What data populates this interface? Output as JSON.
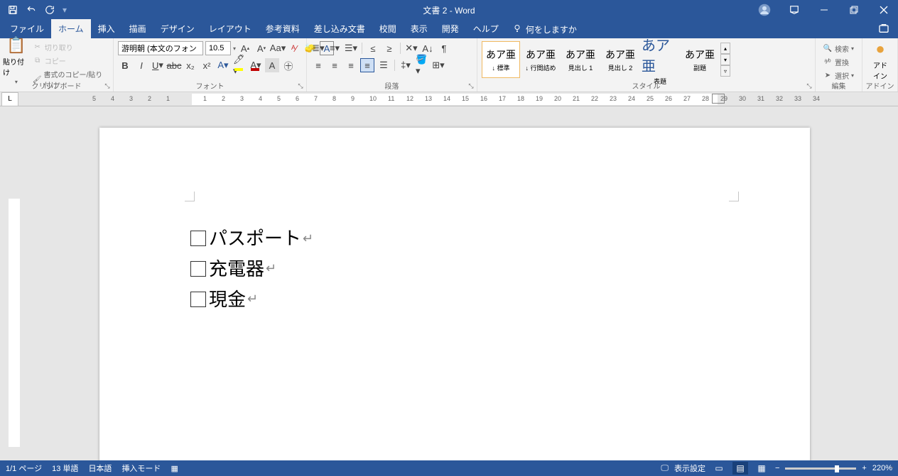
{
  "titlebar": {
    "title": "文書 2  -  Word"
  },
  "tabs": {
    "file": "ファイル",
    "home": "ホーム",
    "insert": "挿入",
    "draw": "描画",
    "design": "デザイン",
    "layout": "レイアウト",
    "references": "参考資料",
    "mailings": "差し込み文書",
    "review": "校閲",
    "view": "表示",
    "developer": "開発",
    "help": "ヘルプ",
    "tell_me": "何をしますか"
  },
  "ribbon": {
    "clipboard": {
      "label": "クリップボード",
      "paste": "貼り付け",
      "cut": "切り取り",
      "copy": "コピー",
      "format_painter": "書式のコピー/貼り付け"
    },
    "font": {
      "label": "フォント",
      "name": "游明朝 (本文のフォン",
      "size": "10.5"
    },
    "paragraph": {
      "label": "段落"
    },
    "styles": {
      "label": "スタイル",
      "items": [
        {
          "preview": "あア亜",
          "name": "↓ 標準"
        },
        {
          "preview": "あア亜",
          "name": "↓ 行間詰め"
        },
        {
          "preview": "あア亜",
          "name": "見出し 1"
        },
        {
          "preview": "あア亜",
          "name": "見出し 2"
        },
        {
          "preview": "あア亜",
          "name": "表題"
        },
        {
          "preview": "あア亜",
          "name": "副題"
        }
      ]
    },
    "editing": {
      "label": "編集",
      "find": "検索",
      "replace": "置換",
      "select": "選択"
    },
    "addins": {
      "label": "アドイン",
      "btn": "アド\nイン"
    }
  },
  "document": {
    "lines": [
      "パスポート",
      "充電器",
      "現金"
    ]
  },
  "statusbar": {
    "page": "1/1 ページ",
    "words": "13 単語",
    "lang": "日本語",
    "mode": "挿入モード",
    "display": "表示設定",
    "zoom": "220%"
  }
}
